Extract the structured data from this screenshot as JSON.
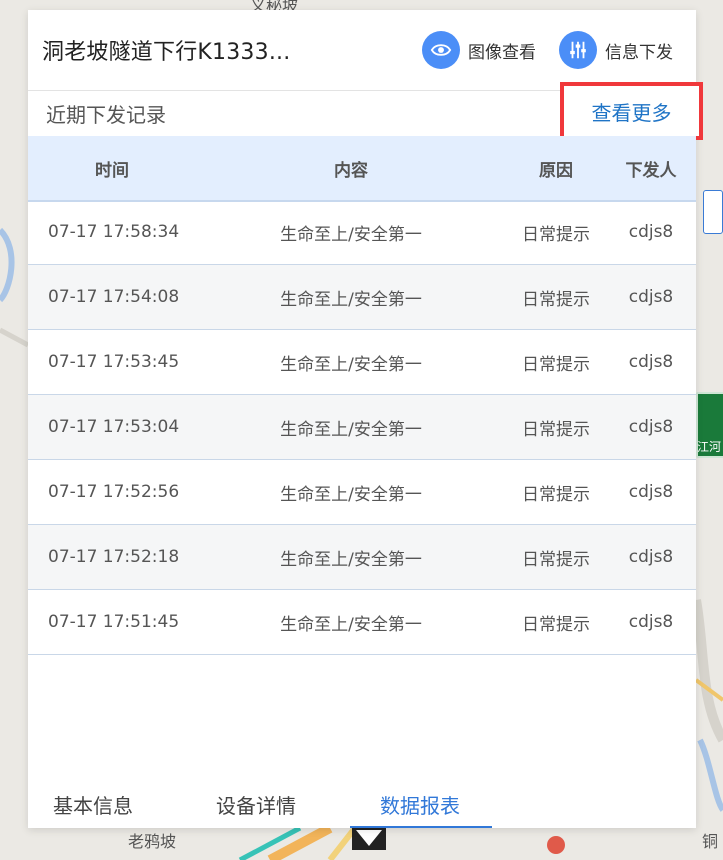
{
  "panel": {
    "title": "洞老坡隧道下行K1333...",
    "actions": {
      "image_view": "图像查看",
      "info_publish": "信息下发"
    }
  },
  "records": {
    "title": "近期下发记录",
    "more": "查看更多",
    "columns": {
      "time": "时间",
      "content": "内容",
      "reason": "原因",
      "user": "下发人"
    },
    "rows": [
      {
        "time": "07-17 17:58:34",
        "content": "生命至上/安全第一",
        "reason": "日常提示",
        "user": "cdjs8"
      },
      {
        "time": "07-17 17:54:08",
        "content": "生命至上/安全第一",
        "reason": "日常提示",
        "user": "cdjs8"
      },
      {
        "time": "07-17 17:53:45",
        "content": "生命至上/安全第一",
        "reason": "日常提示",
        "user": "cdjs8"
      },
      {
        "time": "07-17 17:53:04",
        "content": "生命至上/安全第一",
        "reason": "日常提示",
        "user": "cdjs8"
      },
      {
        "time": "07-17 17:52:56",
        "content": "生命至上/安全第一",
        "reason": "日常提示",
        "user": "cdjs8"
      },
      {
        "time": "07-17 17:52:18",
        "content": "生命至上/安全第一",
        "reason": "日常提示",
        "user": "cdjs8"
      },
      {
        "time": "07-17 17:51:45",
        "content": "生命至上/安全第一",
        "reason": "日常提示",
        "user": "cdjs8"
      }
    ]
  },
  "tabs": {
    "basic": "基本信息",
    "device": "设备详情",
    "report": "数据报表",
    "active": "数据报表"
  },
  "map": {
    "place_bottom": "老鸦坡",
    "place_top": "义秘坡",
    "right_label_1": "江河",
    "right_label_2": "铜"
  },
  "colors": {
    "accent": "#3178d8",
    "icon_bg": "#4b8ef7",
    "highlight_box": "#f0383b",
    "table_header_bg": "#e3eefe"
  },
  "icons": {
    "image_view": "eye-icon",
    "info_publish": "sliders-icon"
  }
}
